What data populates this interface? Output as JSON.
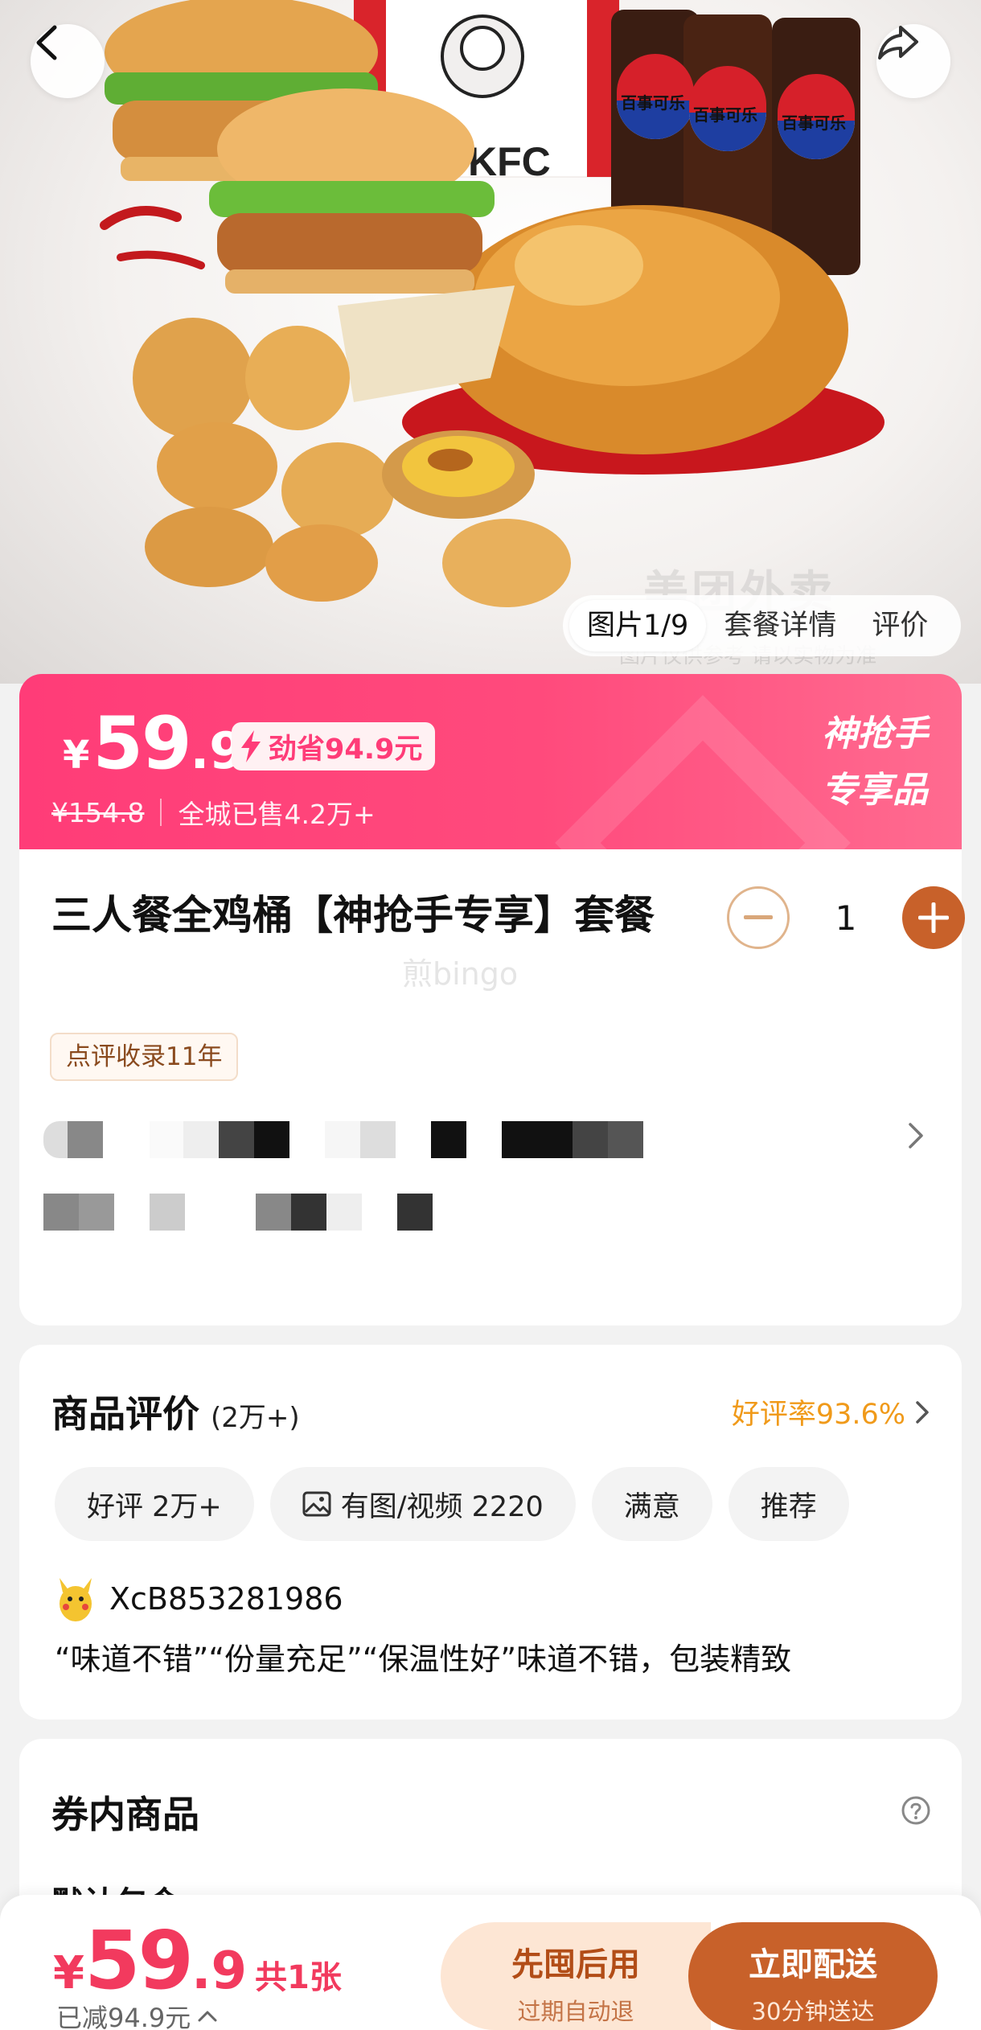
{
  "hero": {
    "watermark": "美团外卖",
    "watermark_sub": "图片仅供参考 请以实物为准",
    "tabs": [
      "图片1/9",
      "套餐详情",
      "评价"
    ],
    "cup_label": "百事可乐",
    "bucket_label": "KFC"
  },
  "price": {
    "currency": "¥",
    "integer": "59",
    "decimal": ".9",
    "save_label": "劲省94.9元",
    "original": "¥154.8",
    "sold": "全城已售4.2万+",
    "exclusive_line1": "神抢手",
    "exclusive_line2": "专享品"
  },
  "product": {
    "title": "三人餐全鸡桶【神抢手专享】套餐",
    "quantity": "1",
    "watermark": "煎bingo",
    "tag": "点评收录11年"
  },
  "review": {
    "title": "商品评价",
    "count": "(2万+)",
    "good_rate": "好评率93.6%",
    "chips": [
      "好评 2万+",
      "有图/视频 2220",
      "满意",
      "推荐"
    ],
    "reviewer_name": "XcB853281986",
    "text": "“味道不错”“份量充足”“保温性好”味道不错，包装精致"
  },
  "voucher": {
    "title": "券内商品",
    "subtitle": "默认包含"
  },
  "bottom": {
    "currency": "¥",
    "integer": "59",
    "decimal": ".9",
    "count": "共1张",
    "saved": "已减94.9元",
    "later_label": "先囤后用",
    "later_sub": "过期自动退",
    "deliver_label": "立即配送",
    "deliver_sub": "30分钟送达"
  },
  "colors": {
    "banner_pink": "#ff3c78",
    "accent_brown": "#c8612a",
    "price_red": "#f23a5e",
    "rate_orange": "#f09a1a"
  }
}
